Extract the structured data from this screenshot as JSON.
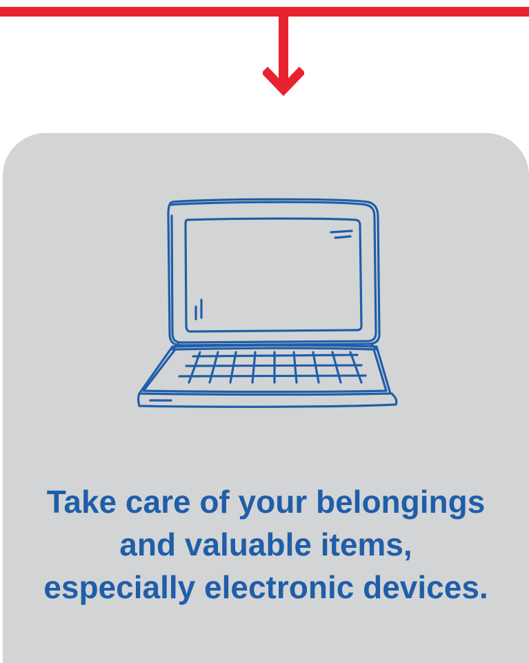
{
  "connector": {
    "color": "#e8232f",
    "icon": "down-arrow-icon"
  },
  "card": {
    "background": "#d3d4d6",
    "icon": "laptop-icon",
    "icon_color": "#1f5ea8",
    "message_lines": [
      "Take care of your belongings",
      "and valuable items,",
      "especially electronic devices."
    ],
    "message_color": "#1f5ea8"
  }
}
